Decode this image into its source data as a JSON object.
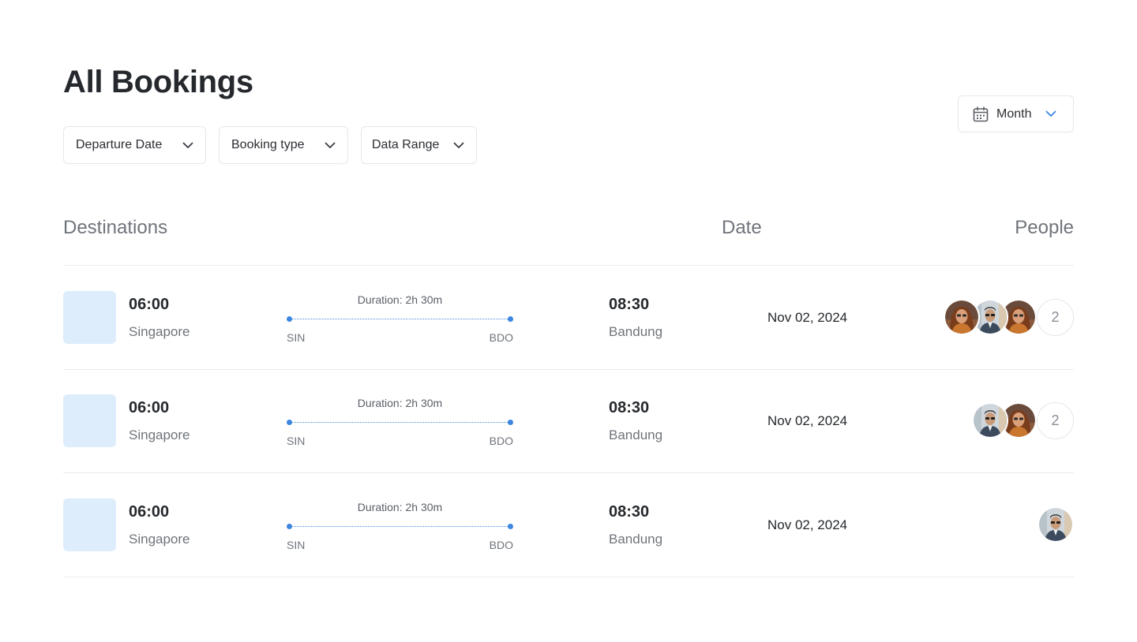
{
  "page": {
    "title": "All Bookings"
  },
  "filters": [
    {
      "label": "Departure Date"
    },
    {
      "label": "Booking type"
    },
    {
      "label": "Data Range"
    }
  ],
  "period_select": {
    "label": "Month",
    "icon": "calendar-icon",
    "accent": "#3d86e0"
  },
  "columns": {
    "destinations": "Destinations",
    "date": "Date",
    "people": "People"
  },
  "bookings": [
    {
      "departure_time": "06:00",
      "departure_city": "Singapore",
      "arrival_time": "08:30",
      "arrival_city": "Bandung",
      "duration": "Duration: 2h 30m",
      "from_code": "SIN",
      "to_code": "BDO",
      "date": "Nov 02, 2024",
      "avatars": [
        "woman-avatar",
        "man-avatar",
        "woman-avatar"
      ],
      "extra_count": "2"
    },
    {
      "departure_time": "06:00",
      "departure_city": "Singapore",
      "arrival_time": "08:30",
      "arrival_city": "Bandung",
      "duration": "Duration: 2h 30m",
      "from_code": "SIN",
      "to_code": "BDO",
      "date": "Nov 02, 2024",
      "avatars": [
        "man-avatar",
        "woman-avatar"
      ],
      "extra_count": "2"
    },
    {
      "departure_time": "06:00",
      "departure_city": "Singapore",
      "arrival_time": "08:30",
      "arrival_city": "Bandung",
      "duration": "Duration: 2h 30m",
      "from_code": "SIN",
      "to_code": "BDO",
      "date": "Nov 02, 2024",
      "avatars": [
        "man-avatar"
      ],
      "extra_count": ""
    }
  ],
  "colors": {
    "route_accent": "#3d86e0",
    "thumbnail": "#ddedfc",
    "heading": "#25282c",
    "muted": "#6f747b"
  }
}
